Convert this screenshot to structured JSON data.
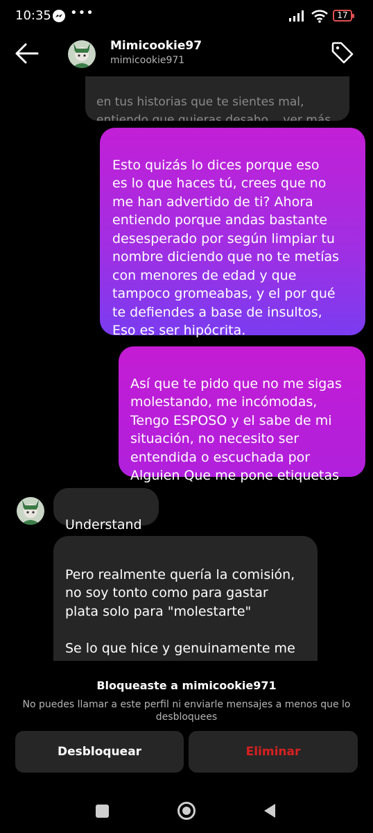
{
  "status": {
    "time": "10:35",
    "dots": "•••",
    "battery": "17"
  },
  "header": {
    "name": "Mimicookie97",
    "username": "mimicookie971"
  },
  "messages": [
    {
      "from": "them",
      "text": "en tus historias que te sientes mal,\nentiendo que quieras desaho... ver más"
    },
    {
      "from": "me",
      "text": "Esto quizás lo dices porque eso\nes lo que haces tú, crees que no\nme han advertido de ti? Ahora\nentiendo porque andas bastante\ndesesperado por según limpiar tu\nnombre diciendo que no te metías\ncon menores de edad y que\ntampoco gromeabas, y el por qué\nte defiendes a base de insultos,\nEso es ser hipócrita."
    },
    {
      "from": "me",
      "text": "Así que te pido que no me sigas\nmolestando, me incómodas,\nTengo ESPOSO y el sabe de mi\nsituación, no necesito ser\nentendida o escuchada por\nAlguien Que me pone etiquetas"
    },
    {
      "from": "them",
      "text": "Understand"
    },
    {
      "from": "them",
      "text": "Pero realmente quería la comisión,\nno soy  tonto como para gastar\nplata solo para \"molestarte\"\n\nSe lo que hice y genuinamente me\narrepiento de eso y de"
    }
  ],
  "blocked": {
    "title": "Bloqueaste a mimicookie971",
    "description": "No puedes llamar a este perfil ni enviarle mensajes a menos que lo desbloquees",
    "unblock_label": "Desbloquear",
    "delete_label": "Eliminar"
  },
  "colors": {
    "accent_delete": "#d82020",
    "bubble_received": "#262626",
    "sent_gradient_top": "#c21fd6",
    "sent_gradient_bottom": "#7a3cf0"
  },
  "icons": [
    "back-arrow-icon",
    "tag-icon",
    "signal-icon",
    "wifi-icon",
    "battery-icon",
    "messenger-icon",
    "nav-recents-icon",
    "nav-home-icon",
    "nav-back-icon"
  ]
}
